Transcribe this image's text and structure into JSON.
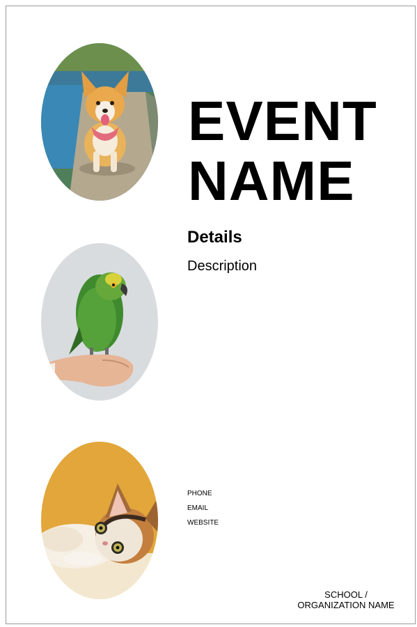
{
  "event": {
    "title_line1": "EVENT",
    "title_line2": "NAME",
    "details_heading": "Details",
    "description": "Description"
  },
  "contact": {
    "phone": "PHONE",
    "email": "EMAIL",
    "website": "WEBSITE"
  },
  "organization": {
    "line1": "SCHOOL /",
    "line2": "ORGANIZATION NAME"
  },
  "photos": [
    {
      "icon": "corgi-dog-photo"
    },
    {
      "icon": "green-parrot-photo"
    },
    {
      "icon": "kitten-photo"
    }
  ],
  "colors": {
    "text": "#000000",
    "border": "#9a9a9a",
    "cat_background": "#e2a63a"
  }
}
